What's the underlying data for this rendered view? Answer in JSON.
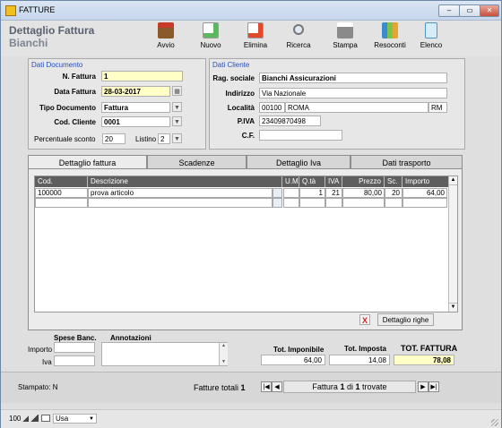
{
  "window": {
    "title": "FATTURE",
    "min": "‒",
    "max": "▭",
    "close": "✕"
  },
  "header": {
    "line1": "Dettaglio Fattura",
    "line2": "Bianchi"
  },
  "toolbar": [
    {
      "label": "Avvio",
      "icon": "home-icon"
    },
    {
      "label": "Nuovo",
      "icon": "new-document-icon"
    },
    {
      "label": "Elimina",
      "icon": "delete-document-icon"
    },
    {
      "label": "Ricerca",
      "icon": "magnifier-icon"
    },
    {
      "label": "Stampa",
      "icon": "printer-icon"
    },
    {
      "label": "Resoconti",
      "icon": "report-icon"
    },
    {
      "label": "Elenco",
      "icon": "list-icon"
    }
  ],
  "documento": {
    "legend": "Dati Documento",
    "n_fattura_label": "N. Fattura",
    "n_fattura": "1",
    "data_label": "Data Fattura",
    "data": "28-03-2017",
    "tipo_label": "Tipo Documento",
    "tipo": "Fattura",
    "cliente_label": "Cod. Cliente",
    "cliente": "0001",
    "sconto_label": "Percentuale sconto",
    "sconto": "20",
    "listino_label": "Listino",
    "listino": "2"
  },
  "cliente": {
    "legend": "Dati Cliente",
    "rag_label": "Rag. sociale",
    "rag": "Bianchi Assicurazioni",
    "ind_label": "Indirizzo",
    "ind": "Via Nazionale",
    "loc_label": "Località",
    "cap": "00100",
    "loc": "ROMA",
    "prov": "RM",
    "piva_label": "P.IVA",
    "piva": "23409870498",
    "cf_label": "C.F.",
    "cf": ""
  },
  "tabs": [
    "Dettaglio fattura",
    "Scadenze",
    "Dettaglio Iva",
    "Dati trasporto"
  ],
  "grid": {
    "headers": [
      "Cod.",
      "Descrizione",
      "U.M.",
      "Q.tà",
      "IVA",
      "Prezzo",
      "Sc.",
      "Importo"
    ],
    "rows": [
      {
        "cod": "100000",
        "desc": "prova articolo",
        "um": "",
        "qta": "1",
        "iva": "21",
        "prezzo": "80,00",
        "sc": "20",
        "importo": "64,00"
      },
      {
        "cod": "",
        "desc": "",
        "um": "",
        "qta": "",
        "iva": "",
        "prezzo": "",
        "sc": "",
        "importo": ""
      }
    ]
  },
  "delete_x": "X",
  "dettaglio_righe": "Dettaglio righe",
  "spese": {
    "title": "Spese Banc.",
    "importo_label": "Importo",
    "iva_label": "Iva",
    "importo": "",
    "iva": ""
  },
  "annotazioni": {
    "title": "Annotazioni",
    "value": ""
  },
  "totali": {
    "imponibile_label": "Tot. Imponibile",
    "imponibile": "64,00",
    "imposta_label": "Tot. Imposta",
    "imposta": "14,08",
    "fattura_label": "TOT. FATTURA",
    "fattura": "78,08"
  },
  "footer": {
    "stampato": "Stampato: N",
    "fatture_totali_label": "Fatture totali",
    "fatture_totali": "1",
    "nav_pre": "Fattura",
    "nav_cur": "1",
    "nav_mid": "di",
    "nav_tot": "1",
    "nav_post": "trovate"
  },
  "status": {
    "zoom": "100",
    "lang": "Usa"
  }
}
